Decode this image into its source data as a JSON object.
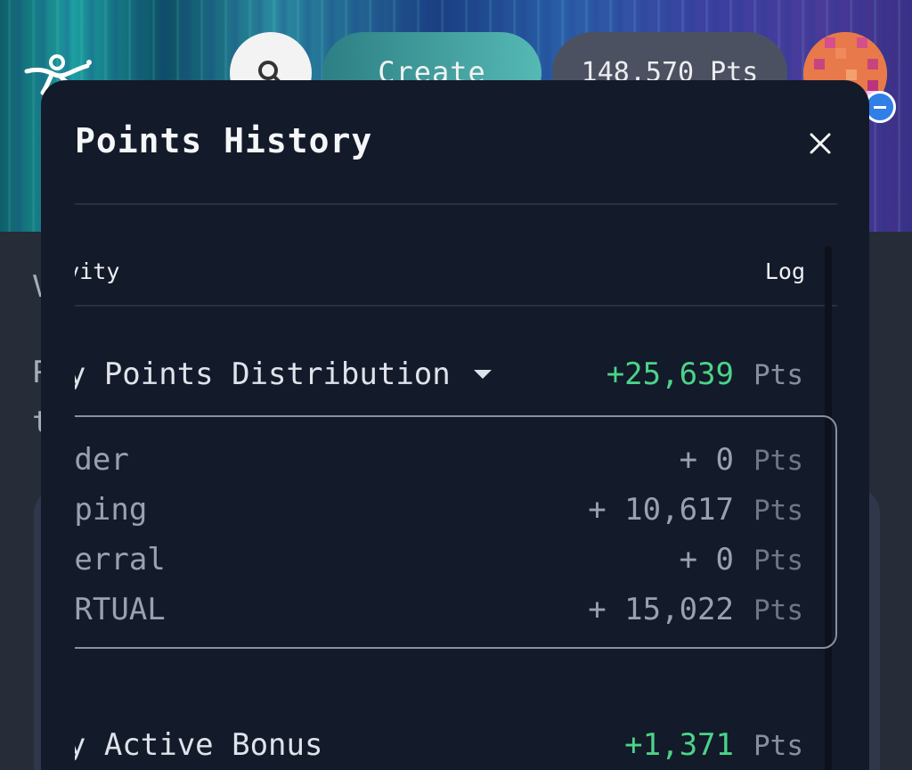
{
  "header": {
    "create_label": "Create",
    "points_label": "148,570 Pts",
    "search_icon": "search-icon",
    "logo_icon": "brand-logo"
  },
  "background": {
    "line1": "V",
    "line2": "P",
    "line3": "t"
  },
  "modal": {
    "title": "Points History",
    "close_icon": "close-icon",
    "columns": {
      "activity": "Activity",
      "log": "Log"
    },
    "distribution": {
      "label": "Daily Points Distribution",
      "amount": "+25,639",
      "unit": "Pts",
      "expanded": true,
      "items": [
        {
          "label": "Trader",
          "amount": "+ 0",
          "unit": "Pts"
        },
        {
          "label": "Tapping",
          "amount": "+ 10,617",
          "unit": "Pts"
        },
        {
          "label": "Referral",
          "amount": "+ 0",
          "unit": "Pts"
        },
        {
          "label": "$VIRTUAL",
          "amount": "+ 15,022",
          "unit": "Pts"
        }
      ]
    },
    "bonus": {
      "label": "Daily Active Bonus",
      "amount": "+1,371",
      "unit": "Pts"
    }
  },
  "colors": {
    "modal_bg": "#131a29",
    "positive": "#4bd38a",
    "create_gradient_end": "#55b9b4"
  }
}
